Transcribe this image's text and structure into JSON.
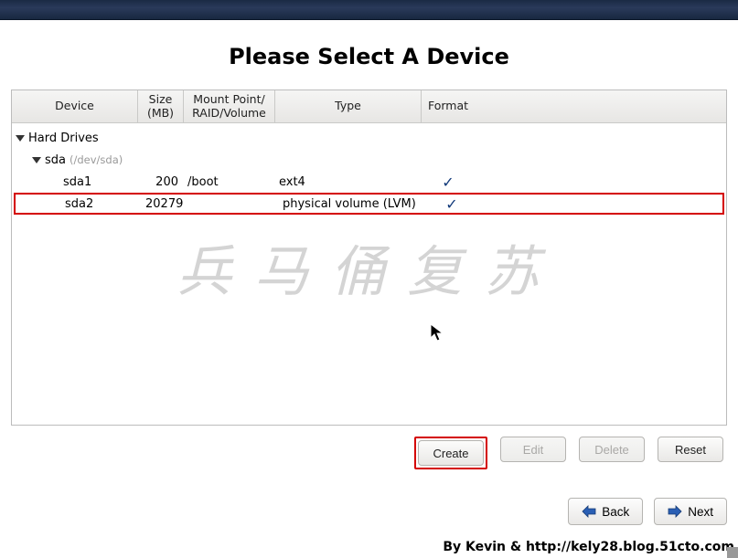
{
  "title": "Please Select A Device",
  "columns": {
    "device": "Device",
    "size": "Size\n(MB)",
    "mount": "Mount Point/\nRAID/Volume",
    "type": "Type",
    "format": "Format"
  },
  "tree": {
    "root_label": "Hard Drives",
    "disk": {
      "name": "sda",
      "path": "(/dev/sda)"
    },
    "partitions": [
      {
        "name": "sda1",
        "size": "200",
        "mount": "/boot",
        "type": "ext4",
        "format_check": "✓",
        "highlighted": false
      },
      {
        "name": "sda2",
        "size": "20279",
        "mount": "",
        "type": "physical volume (LVM)",
        "format_check": "✓",
        "highlighted": true
      }
    ]
  },
  "buttons": {
    "create": "Create",
    "edit": "Edit",
    "delete": "Delete",
    "reset": "Reset"
  },
  "nav": {
    "back": "Back",
    "next": "Next"
  },
  "watermark": "兵马俑复苏",
  "credit": "By Kevin & http://kely28.blog.51cto.com"
}
